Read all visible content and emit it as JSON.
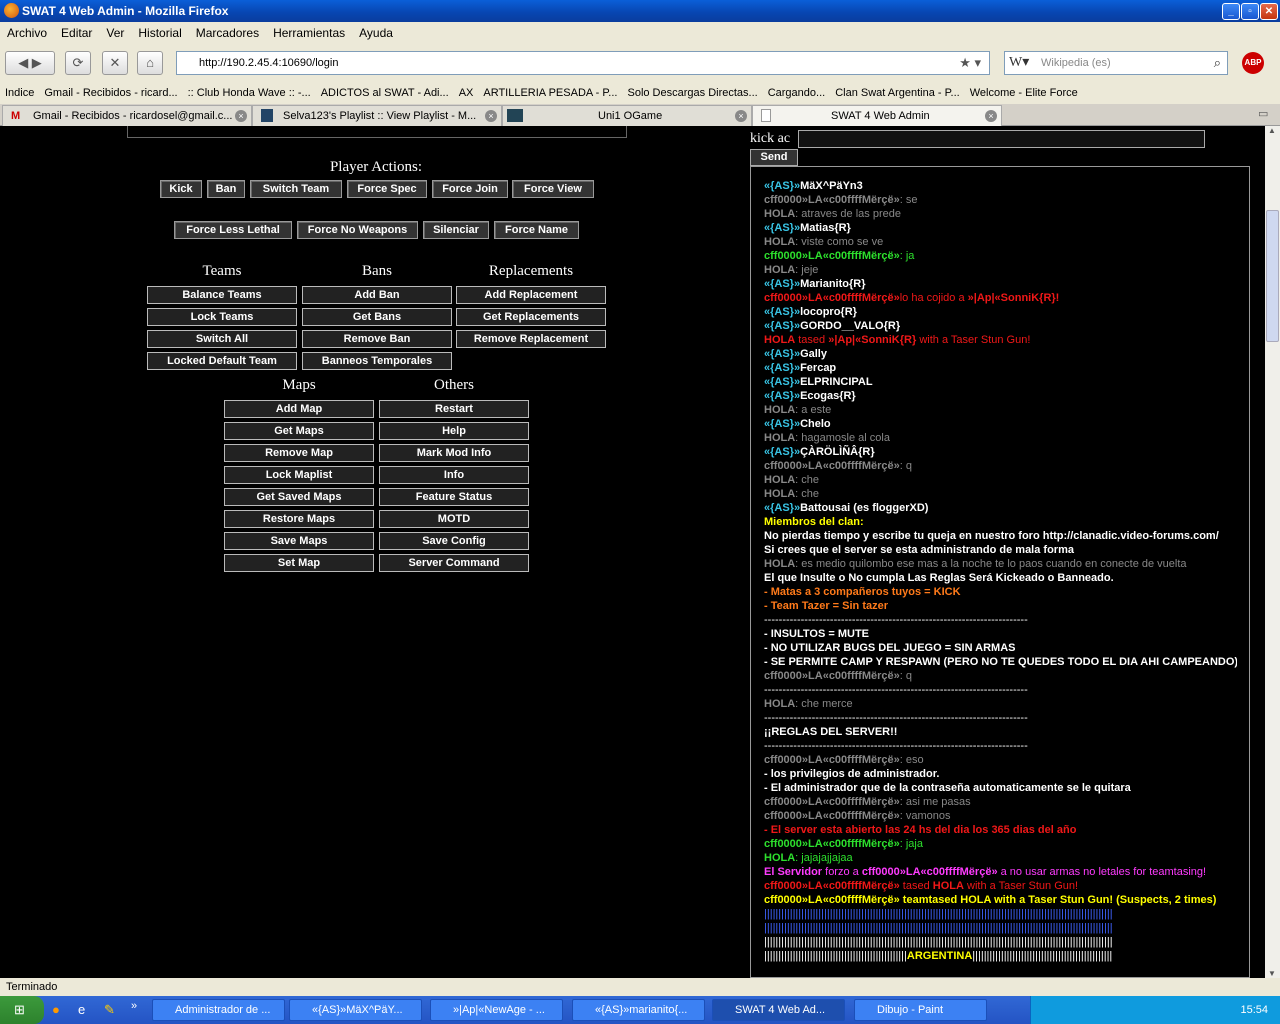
{
  "window": {
    "title": "SWAT 4 Web Admin - Mozilla Firefox"
  },
  "menu": [
    "Archivo",
    "Editar",
    "Ver",
    "Historial",
    "Marcadores",
    "Herramientas",
    "Ayuda"
  ],
  "nav": {
    "url": "http://190.2.45.4:10690/login",
    "search_placeholder": "Wikipedia (es)",
    "abp_label": "ABP"
  },
  "bookmarks": [
    "Indice",
    "Gmail - Recibidos - ricard...",
    ":: Club Honda Wave :: -...",
    "ADICTOS al SWAT - Adi...",
    "AX",
    "ARTILLERIA PESADA - P...",
    "Solo Descargas Directas...",
    "Cargando...",
    "Clan Swat Argentina - P...",
    "Welcome - Elite Force"
  ],
  "tabs": [
    {
      "label": "Gmail - Recibidos - ricardosel@gmail.c..."
    },
    {
      "label": "Selva123's Playlist :: View Playlist - M..."
    },
    {
      "label": "Uni1 OGame"
    },
    {
      "label": "SWAT 4 Web Admin"
    }
  ],
  "admin": {
    "player_actions_title": "Player Actions:",
    "player_actions_row1": [
      "Kick",
      "Ban",
      "Switch Team",
      "Force Spec",
      "Force Join",
      "Force View"
    ],
    "player_actions_row2": [
      "Force Less Lethal",
      "Force No Weapons",
      "Silenciar",
      "Force Name"
    ],
    "teams_title": "Teams",
    "bans_title": "Bans",
    "replacements_title": "Replacements",
    "teams": [
      "Balance Teams",
      "Lock Teams",
      "Switch All",
      "Locked Default Team"
    ],
    "bans": [
      "Add Ban",
      "Get Bans",
      "Remove Ban",
      "Banneos Temporales"
    ],
    "replacements": [
      "Add Replacement",
      "Get Replacements",
      "Remove Replacement"
    ],
    "maps_title": "Maps",
    "others_title": "Others",
    "maps": [
      "Add Map",
      "Get Maps",
      "Remove Map",
      "Lock Maplist",
      "Get Saved Maps",
      "Restore Maps",
      "Save Maps",
      "Set Map"
    ],
    "others": [
      "Restart",
      "Help",
      "Mark Mod Info",
      "Info",
      "Feature Status",
      "MOTD",
      "Save Config",
      "Server Command"
    ]
  },
  "chat_input": {
    "label": "kick ac",
    "send": "Send"
  },
  "chat": [
    [
      [
        "cyan",
        "«{AS}»"
      ],
      [
        "wht",
        "MäX^PäYn3"
      ]
    ],
    [
      [
        "grb",
        "cff0000»LA«c00ffffMërçë»"
      ],
      [
        "gry",
        ": se"
      ]
    ],
    [
      [
        "grb",
        "HOLA"
      ],
      [
        "gry",
        ": atraves de las prede"
      ]
    ],
    [
      [
        "cyan",
        "«{AS}»"
      ],
      [
        "wht",
        "Matias{R}"
      ]
    ],
    [
      [
        "grb",
        "HOLA"
      ],
      [
        "gry",
        ": viste como se ve"
      ]
    ],
    [
      [
        "grn",
        "cff0000»LA«c00ffffMërçë»"
      ],
      [
        "grnn",
        ": ja"
      ]
    ],
    [
      [
        "grb",
        "HOLA"
      ],
      [
        "gry",
        ": jeje"
      ]
    ],
    [
      [
        "cyan",
        "«{AS}»"
      ],
      [
        "wht",
        "Marianito{R}"
      ]
    ],
    [
      [
        "redb",
        "cff0000»LA«c00ffffMërçë»"
      ],
      [
        "red",
        "lo ha cojido a "
      ],
      [
        "redb",
        "»|Ap|«SonniK{R}!"
      ]
    ],
    [
      [
        "cyan",
        "«{AS}»"
      ],
      [
        "wht",
        "locopro{R}"
      ]
    ],
    [
      [
        "cyan",
        "«{AS}»"
      ],
      [
        "wht",
        "GORDO__VALO{R}"
      ]
    ],
    [
      [
        "redb",
        "HOLA"
      ],
      [
        "red",
        " tased "
      ],
      [
        "redb",
        "»|Ap|«SonniK{R}"
      ],
      [
        "red",
        " with a Taser Stun Gun!"
      ]
    ],
    [
      [
        "cyan",
        "«{AS}»"
      ],
      [
        "wht",
        "Gally"
      ]
    ],
    [
      [
        "cyan",
        "«{AS}»"
      ],
      [
        "wht",
        "Fercap"
      ]
    ],
    [
      [
        "cyan",
        "«{AS}»"
      ],
      [
        "wht",
        "ELPRINCIPAL"
      ]
    ],
    [
      [
        "cyan",
        "«{AS}»"
      ],
      [
        "wht",
        "Ecogas{R}"
      ]
    ],
    [
      [
        "grb",
        "HOLA"
      ],
      [
        "gry",
        ": a este"
      ]
    ],
    [
      [
        "cyan",
        "«{AS}»"
      ],
      [
        "wht",
        "Chelo"
      ]
    ],
    [
      [
        "grb",
        "HOLA"
      ],
      [
        "gry",
        ": hagamosle al cola"
      ]
    ],
    [
      [
        "cyan",
        "«{AS}»"
      ],
      [
        "wht",
        "ÇÀRÖLÌÑÂ{R}"
      ]
    ],
    [
      [
        "grb",
        "cff0000»LA«c00ffffMërçë»"
      ],
      [
        "gry",
        ": q"
      ]
    ],
    [
      [
        "grb",
        "HOLA"
      ],
      [
        "gry",
        ": che"
      ]
    ],
    [
      [
        "grb",
        "HOLA"
      ],
      [
        "gry",
        ": che"
      ]
    ],
    [
      [
        "cyan",
        "«{AS}»"
      ],
      [
        "wht",
        "Battousai (es floggerXD)"
      ]
    ],
    [
      [
        "yel",
        "Miembros del clan:"
      ]
    ],
    [
      [
        "wht",
        "No pierdas tiempo y escribe tu queja en nuestro foro http://clanadic.video-forums.com/"
      ]
    ],
    [
      [
        "wht",
        "Si crees que el server se esta administrando de mala forma"
      ]
    ],
    [
      [
        "grb",
        "HOLA"
      ],
      [
        "gry",
        ": es medio quilombo ese mas a la noche te lo paos cuando en conecte de vuelta"
      ]
    ],
    [
      [
        "wht",
        "El que Insulte o No cumpla Las Reglas Será Kickeado o Banneado."
      ]
    ],
    [
      [
        "ora",
        "- Matas a 3 compañeros tuyos = KICK"
      ]
    ],
    [
      [
        "ora",
        "- Team Tazer = Sin tazer"
      ]
    ],
    [
      [
        "bar",
        "------------------------------------------------------------------------"
      ]
    ],
    [
      [
        "wht",
        "- INSULTOS = MUTE"
      ]
    ],
    [
      [
        "wht",
        "- NO UTILIZAR BUGS DEL JUEGO = SIN ARMAS"
      ]
    ],
    [
      [
        "wht",
        "- SE PERMITE CAMP Y RESPAWN (PERO NO TE QUEDES TODO EL DIA AHI CAMPEANDO)"
      ]
    ],
    [
      [
        "grb",
        "cff0000»LA«c00ffffMërçë»"
      ],
      [
        "gry",
        ": q"
      ]
    ],
    [
      [
        "bar",
        "------------------------------------------------------------------------"
      ]
    ],
    [
      [
        "grb",
        "HOLA"
      ],
      [
        "gry",
        ": che merce"
      ]
    ],
    [
      [
        "bar",
        "------------------------------------------------------------------------"
      ]
    ],
    [
      [
        "wht",
        "¡¡REGLAS DEL SERVER!!"
      ]
    ],
    [
      [
        "bar",
        "------------------------------------------------------------------------"
      ]
    ],
    [
      [
        "grb",
        "cff0000»LA«c00ffffMërçë»"
      ],
      [
        "gry",
        ": eso"
      ]
    ],
    [
      [
        "wht",
        "- los privilegios de administrador."
      ]
    ],
    [
      [
        "wht",
        "- El administrador que de la contraseña automaticamente se le quitara"
      ]
    ],
    [
      [
        "grb",
        "cff0000»LA«c00ffffMërçë»"
      ],
      [
        "gry",
        ": asi me pasas"
      ]
    ],
    [
      [
        "grb",
        "cff0000»LA«c00ffffMërçë»"
      ],
      [
        "gry",
        ": vamonos"
      ]
    ],
    [
      [
        "redb",
        "- El server esta abierto las 24 hs del dia los 365 dias del año"
      ]
    ],
    [
      [
        "grn",
        "cff0000»LA«c00ffffMërçë»"
      ],
      [
        "grnn",
        ": jaja"
      ]
    ],
    [
      [
        "grn",
        "HOLA"
      ],
      [
        "grnn",
        ": jajajajjajaa"
      ]
    ],
    [
      [
        "mag",
        "El Servidor"
      ],
      [
        "magn",
        " forzo a "
      ],
      [
        "mag",
        "cff0000»LA«c00ffffMërçë»"
      ],
      [
        "magn",
        " a no usar armas no letales for teamtasing!"
      ]
    ],
    [
      [
        "redb",
        "cff0000»LA«c00ffffMërçë»"
      ],
      [
        "red",
        " tased "
      ],
      [
        "redb",
        "HOLA"
      ],
      [
        "red",
        " with a Taser Stun Gun!"
      ]
    ],
    [
      [
        "yel",
        "cff0000»LA«c00ffffMërçë»"
      ],
      [
        "yel",
        " teamtased "
      ],
      [
        "yel",
        "HOLA"
      ],
      [
        "yel",
        " with a Taser Stun Gun! (Suspects, 2 times)"
      ]
    ],
    [
      [
        "blu",
        "||||||||||||||||||||||||||||||||||||||||||||||||||||||||||||||||||||||||||||||||||||||||||||||||||||||||||||||||||||||||||"
      ]
    ],
    [
      [
        "blu",
        "||||||||||||||||||||||||||||||||||||||||||||||||||||||||||||||||||||||||||||||||||||||||||||||||||||||||||||||||||||||||||"
      ]
    ],
    [
      [
        "bar",
        "||||||||||||||||||||||||||||||||||||||||||||||||||||||||||||||||||||||||||||||||||||||||||||||||||||||||||||||||||||||||||"
      ]
    ],
    [
      [
        "bar",
        "||||||||||||||||||||||||||||||||||||||||||||||||||"
      ],
      [
        "yel",
        "ARGENTINA"
      ],
      [
        "bar",
        "|||||||||||||||||||||||||||||||||||||||||||||||||"
      ]
    ]
  ],
  "status": "Terminado",
  "taskbar": {
    "items": [
      "Administrador de ...",
      "«{AS}»MäX^PäY...",
      "»|Ap|«NewAge - ...",
      "«{AS}»marianito{...",
      "SWAT 4 Web Ad...",
      "Dibujo - Paint"
    ],
    "clock": "15:54"
  }
}
